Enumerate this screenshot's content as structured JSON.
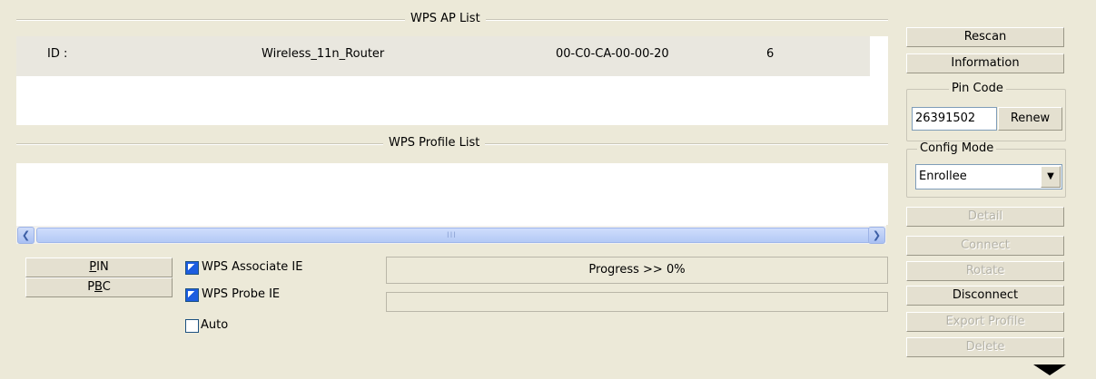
{
  "ap_list": {
    "title": "WPS AP List",
    "rows": [
      {
        "id": "ID :",
        "ssid": "Wireless_11n_Router",
        "bssid": "00-C0-CA-00-00-20",
        "channel": "6"
      }
    ]
  },
  "profile_list": {
    "title": "WPS Profile List",
    "scroll_grip": "III"
  },
  "buttons": {
    "pin_label": "PIN",
    "pin_mnemonic": "P",
    "pin_rest": "IN",
    "pbc_label": "PBC",
    "pbc_lead": "P",
    "pbc_mnemonic": "B",
    "pbc_rest": "C"
  },
  "options": {
    "associate_ie_label": "WPS Associate IE",
    "associate_ie_checked": true,
    "probe_ie_label": "WPS Probe IE",
    "probe_ie_checked": true,
    "auto_label": "Auto",
    "auto_checked": false
  },
  "progress": {
    "text": "Progress >> 0%",
    "value": 0
  },
  "side": {
    "rescan": "Rescan",
    "information": "Information",
    "pin_code_legend": "Pin Code",
    "pin_code_value": "26391502",
    "renew": "Renew",
    "config_mode_legend": "Config Mode",
    "config_mode_value": "Enrollee",
    "detail": "Detail",
    "connect": "Connect",
    "rotate": "Rotate",
    "disconnect": "Disconnect",
    "export_profile": "Export Profile",
    "delete": "Delete"
  }
}
